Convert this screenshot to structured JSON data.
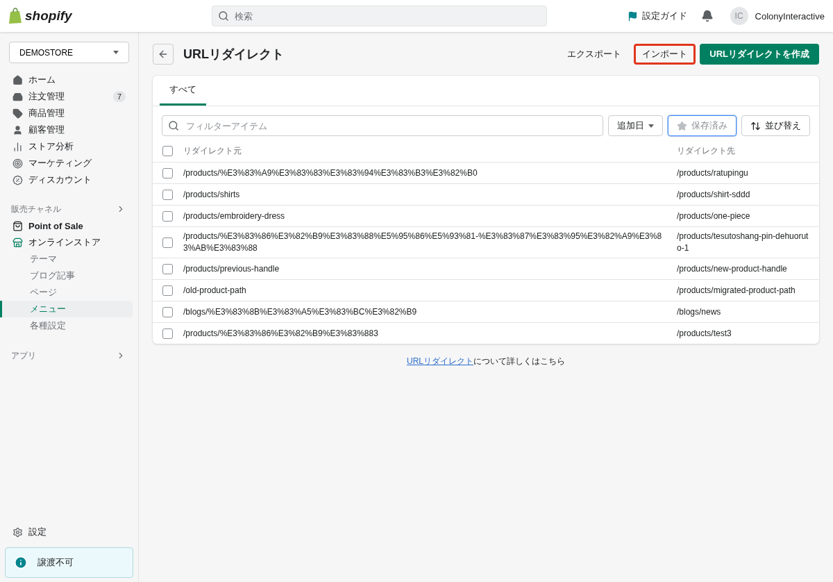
{
  "topbar": {
    "logo": "shopify",
    "search": {
      "placeholder": "検索"
    },
    "guide": "設定ガイド",
    "avatar_initials": "IC",
    "user": "ColonyInteractive"
  },
  "sidebar": {
    "store": "DEMOSTORE",
    "main_items": [
      {
        "label": "ホーム"
      },
      {
        "label": "注文管理",
        "badge": "7"
      },
      {
        "label": "商品管理"
      },
      {
        "label": "顧客管理"
      },
      {
        "label": "ストア分析"
      },
      {
        "label": "マーケティング"
      },
      {
        "label": "ディスカウント"
      }
    ],
    "sales_channels": {
      "label": "販売チャネル",
      "items": [
        {
          "label": "Point of Sale"
        },
        {
          "label": "オンラインストア",
          "children": [
            {
              "label": "テーマ",
              "selected": false
            },
            {
              "label": "ブログ記事",
              "selected": false
            },
            {
              "label": "ページ",
              "selected": false
            },
            {
              "label": "メニュー",
              "selected": true
            },
            {
              "label": "各種設定",
              "selected": false
            }
          ]
        }
      ]
    },
    "apps": {
      "label": "アプリ"
    },
    "settings": "設定",
    "notice": "譲渡不可"
  },
  "page": {
    "title": "URLリダイレクト",
    "actions": [
      {
        "label": "エクスポート",
        "kind": "plain",
        "highlighted": false
      },
      {
        "label": "インポート",
        "kind": "plain",
        "highlighted": true
      },
      {
        "label": "URLリダイレクトを作成",
        "kind": "primary",
        "highlighted": false
      }
    ],
    "tabs": [
      {
        "label": "すべて",
        "selected": true
      }
    ],
    "filter": {
      "placeholder": "フィルターアイテム"
    },
    "filter_buttons": [
      {
        "label": "追加日",
        "kind": "dropdown",
        "disabled": false,
        "focused": false
      },
      {
        "label": "保存済み",
        "kind": "saved",
        "disabled": true,
        "focused": true
      },
      {
        "label": "並び替え",
        "kind": "sort",
        "disabled": false,
        "focused": false
      }
    ],
    "table": {
      "select_all": {
        "checked": false
      },
      "columns": [
        "リダイレクト元",
        "リダイレクト先"
      ],
      "rows": [
        {
          "checked": false,
          "from": "/products/%E3%83%A9%E3%83%83%E3%83%94%E3%83%B3%E3%82%B0",
          "to": "/products/ratupingu"
        },
        {
          "checked": false,
          "from": "/products/shirts",
          "to": "/products/shirt-sddd"
        },
        {
          "checked": false,
          "from": "/products/embroidery-dress",
          "to": "/products/one-piece"
        },
        {
          "checked": false,
          "from": "/products/%E3%83%86%E3%82%B9%E3%83%88%E5%95%86%E5%93%81-%E3%83%87%E3%83%95%E3%82%A9%E3%83%AB%E3%83%88",
          "to": "/products/tesutoshang-pin-dehuoruto-1"
        },
        {
          "checked": false,
          "from": "/products/previous-handle",
          "to": "/products/new-product-handle"
        },
        {
          "checked": false,
          "from": "/old-product-path",
          "to": "/products/migrated-product-path"
        },
        {
          "checked": false,
          "from": "/blogs/%E3%83%8B%E3%83%A5%E3%83%BC%E3%82%B9",
          "to": "/blogs/news"
        },
        {
          "checked": false,
          "from": "/products/%E3%83%86%E3%82%B9%E3%83%883",
          "to": "/products/test3"
        }
      ]
    },
    "help": {
      "link": "URLリダイレクト",
      "text": "について詳しくはこちら"
    }
  }
}
